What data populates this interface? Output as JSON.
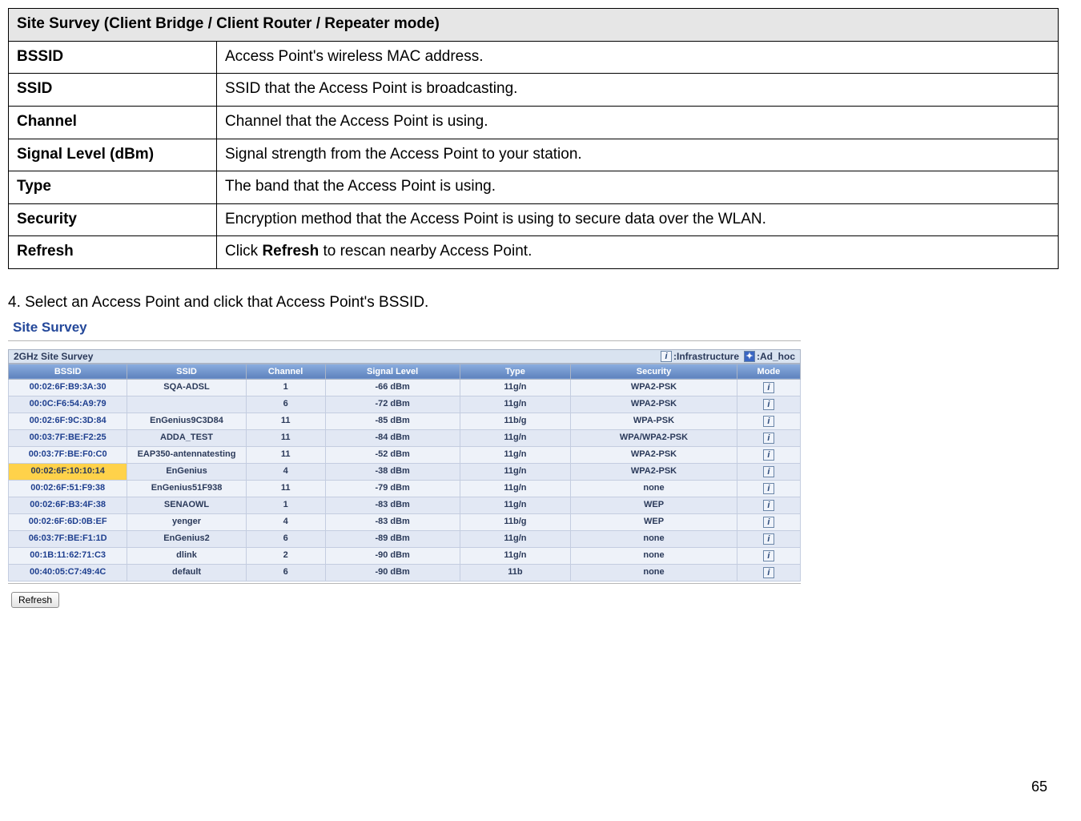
{
  "defTable": {
    "header": "Site Survey (Client Bridge / Client Router / Repeater mode)",
    "rows": [
      {
        "term": "BSSID",
        "desc": "Access Point's wireless MAC address."
      },
      {
        "term": "SSID",
        "desc": "SSID that the Access Point is broadcasting."
      },
      {
        "term": "Channel",
        "desc": "Channel that the Access Point is using."
      },
      {
        "term": "Signal Level (dBm)",
        "desc": "Signal strength from the Access Point to your station."
      },
      {
        "term": "Type",
        "desc": "The band that the Access Point is using."
      },
      {
        "term": "Security",
        "desc": "Encryption method that the Access Point is using to secure data over the WLAN."
      },
      {
        "term": "Refresh",
        "desc_pre": "Click ",
        "desc_bold": "Refresh",
        "desc_post": " to rescan nearby Access Point."
      }
    ]
  },
  "step": "4. Select an Access Point and click that Access Point's BSSID.",
  "shot": {
    "title": "Site Survey",
    "legend": {
      "bar_title": "2GHz Site Survey",
      "infra": ":Infrastructure",
      "adhoc": ":Ad_hoc"
    },
    "columns": [
      "BSSID",
      "SSID",
      "Channel",
      "Signal Level",
      "Type",
      "Security",
      "Mode"
    ],
    "col_widths": [
      "15%",
      "15%",
      "10%",
      "17%",
      "14%",
      "21%",
      "8%"
    ],
    "rows": [
      {
        "bssid": "00:02:6F:B9:3A:30",
        "ssid": "SQA-ADSL",
        "channel": "1",
        "signal": "-66 dBm",
        "type": "11g/n",
        "security": "WPA2-PSK",
        "hl": false
      },
      {
        "bssid": "00:0C:F6:54:A9:79",
        "ssid": "",
        "channel": "6",
        "signal": "-72 dBm",
        "type": "11g/n",
        "security": "WPA2-PSK",
        "hl": false
      },
      {
        "bssid": "00:02:6F:9C:3D:84",
        "ssid": "EnGenius9C3D84",
        "channel": "11",
        "signal": "-85 dBm",
        "type": "11b/g",
        "security": "WPA-PSK",
        "hl": false
      },
      {
        "bssid": "00:03:7F:BE:F2:25",
        "ssid": "ADDA_TEST",
        "channel": "11",
        "signal": "-84 dBm",
        "type": "11g/n",
        "security": "WPA/WPA2-PSK",
        "hl": false
      },
      {
        "bssid": "00:03:7F:BE:F0:C0",
        "ssid": "EAP350-antennatesting",
        "channel": "11",
        "signal": "-52 dBm",
        "type": "11g/n",
        "security": "WPA2-PSK",
        "hl": false
      },
      {
        "bssid": "00:02:6F:10:10:14",
        "ssid": "EnGenius",
        "channel": "4",
        "signal": "-38 dBm",
        "type": "11g/n",
        "security": "WPA2-PSK",
        "hl": true
      },
      {
        "bssid": "00:02:6F:51:F9:38",
        "ssid": "EnGenius51F938",
        "channel": "11",
        "signal": "-79 dBm",
        "type": "11g/n",
        "security": "none",
        "hl": false
      },
      {
        "bssid": "00:02:6F:B3:4F:38",
        "ssid": "SENAOWL",
        "channel": "1",
        "signal": "-83 dBm",
        "type": "11g/n",
        "security": "WEP",
        "hl": false
      },
      {
        "bssid": "00:02:6F:6D:0B:EF",
        "ssid": "yenger",
        "channel": "4",
        "signal": "-83 dBm",
        "type": "11b/g",
        "security": "WEP",
        "hl": false
      },
      {
        "bssid": "06:03:7F:BE:F1:1D",
        "ssid": "EnGenius2",
        "channel": "6",
        "signal": "-89 dBm",
        "type": "11g/n",
        "security": "none",
        "hl": false
      },
      {
        "bssid": "00:1B:11:62:71:C3",
        "ssid": "dlink",
        "channel": "2",
        "signal": "-90 dBm",
        "type": "11g/n",
        "security": "none",
        "hl": false
      },
      {
        "bssid": "00:40:05:C7:49:4C",
        "ssid": "default",
        "channel": "6",
        "signal": "-90 dBm",
        "type": "11b",
        "security": "none",
        "hl": false
      }
    ],
    "refresh": "Refresh"
  },
  "pageNumber": "65"
}
